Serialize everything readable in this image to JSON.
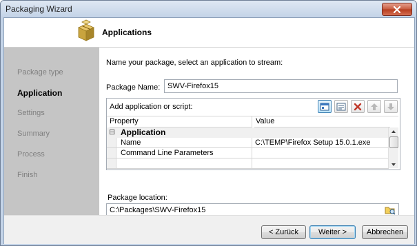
{
  "window": {
    "title": "Packaging Wizard"
  },
  "header": {
    "title": "Applications"
  },
  "steps": [
    {
      "label": "Package type",
      "active": false
    },
    {
      "label": "Application",
      "active": true
    },
    {
      "label": "Settings",
      "active": false
    },
    {
      "label": "Summary",
      "active": false
    },
    {
      "label": "Process",
      "active": false
    },
    {
      "label": "Finish",
      "active": false
    }
  ],
  "main": {
    "instruction": "Name your package, select an application to stream:",
    "package_name_label": "Package Name:",
    "package_name_value": "SWV-Firefox15",
    "add_label": "Add application or script:",
    "grid": {
      "headers": {
        "property": "Property",
        "value": "Value"
      },
      "group_toggle": "⊟",
      "group": "Application",
      "rows": [
        {
          "property": "Name",
          "value": "C:\\TEMP\\Firefox Setup 15.0.1.exe"
        },
        {
          "property": "Command Line Parameters",
          "value": ""
        }
      ]
    },
    "location_label": "Package location:",
    "location_value": "C:\\Packages\\SWV-Firefox15"
  },
  "footer": {
    "back_label": "< Zurück",
    "next_label": "Weiter >",
    "cancel_label": "Abbrechen"
  },
  "colors": {
    "sidebar": "#c5c5c5",
    "accent": "#3c7fb1",
    "delete": "#c0392b",
    "close_button": "#c75a3e"
  }
}
